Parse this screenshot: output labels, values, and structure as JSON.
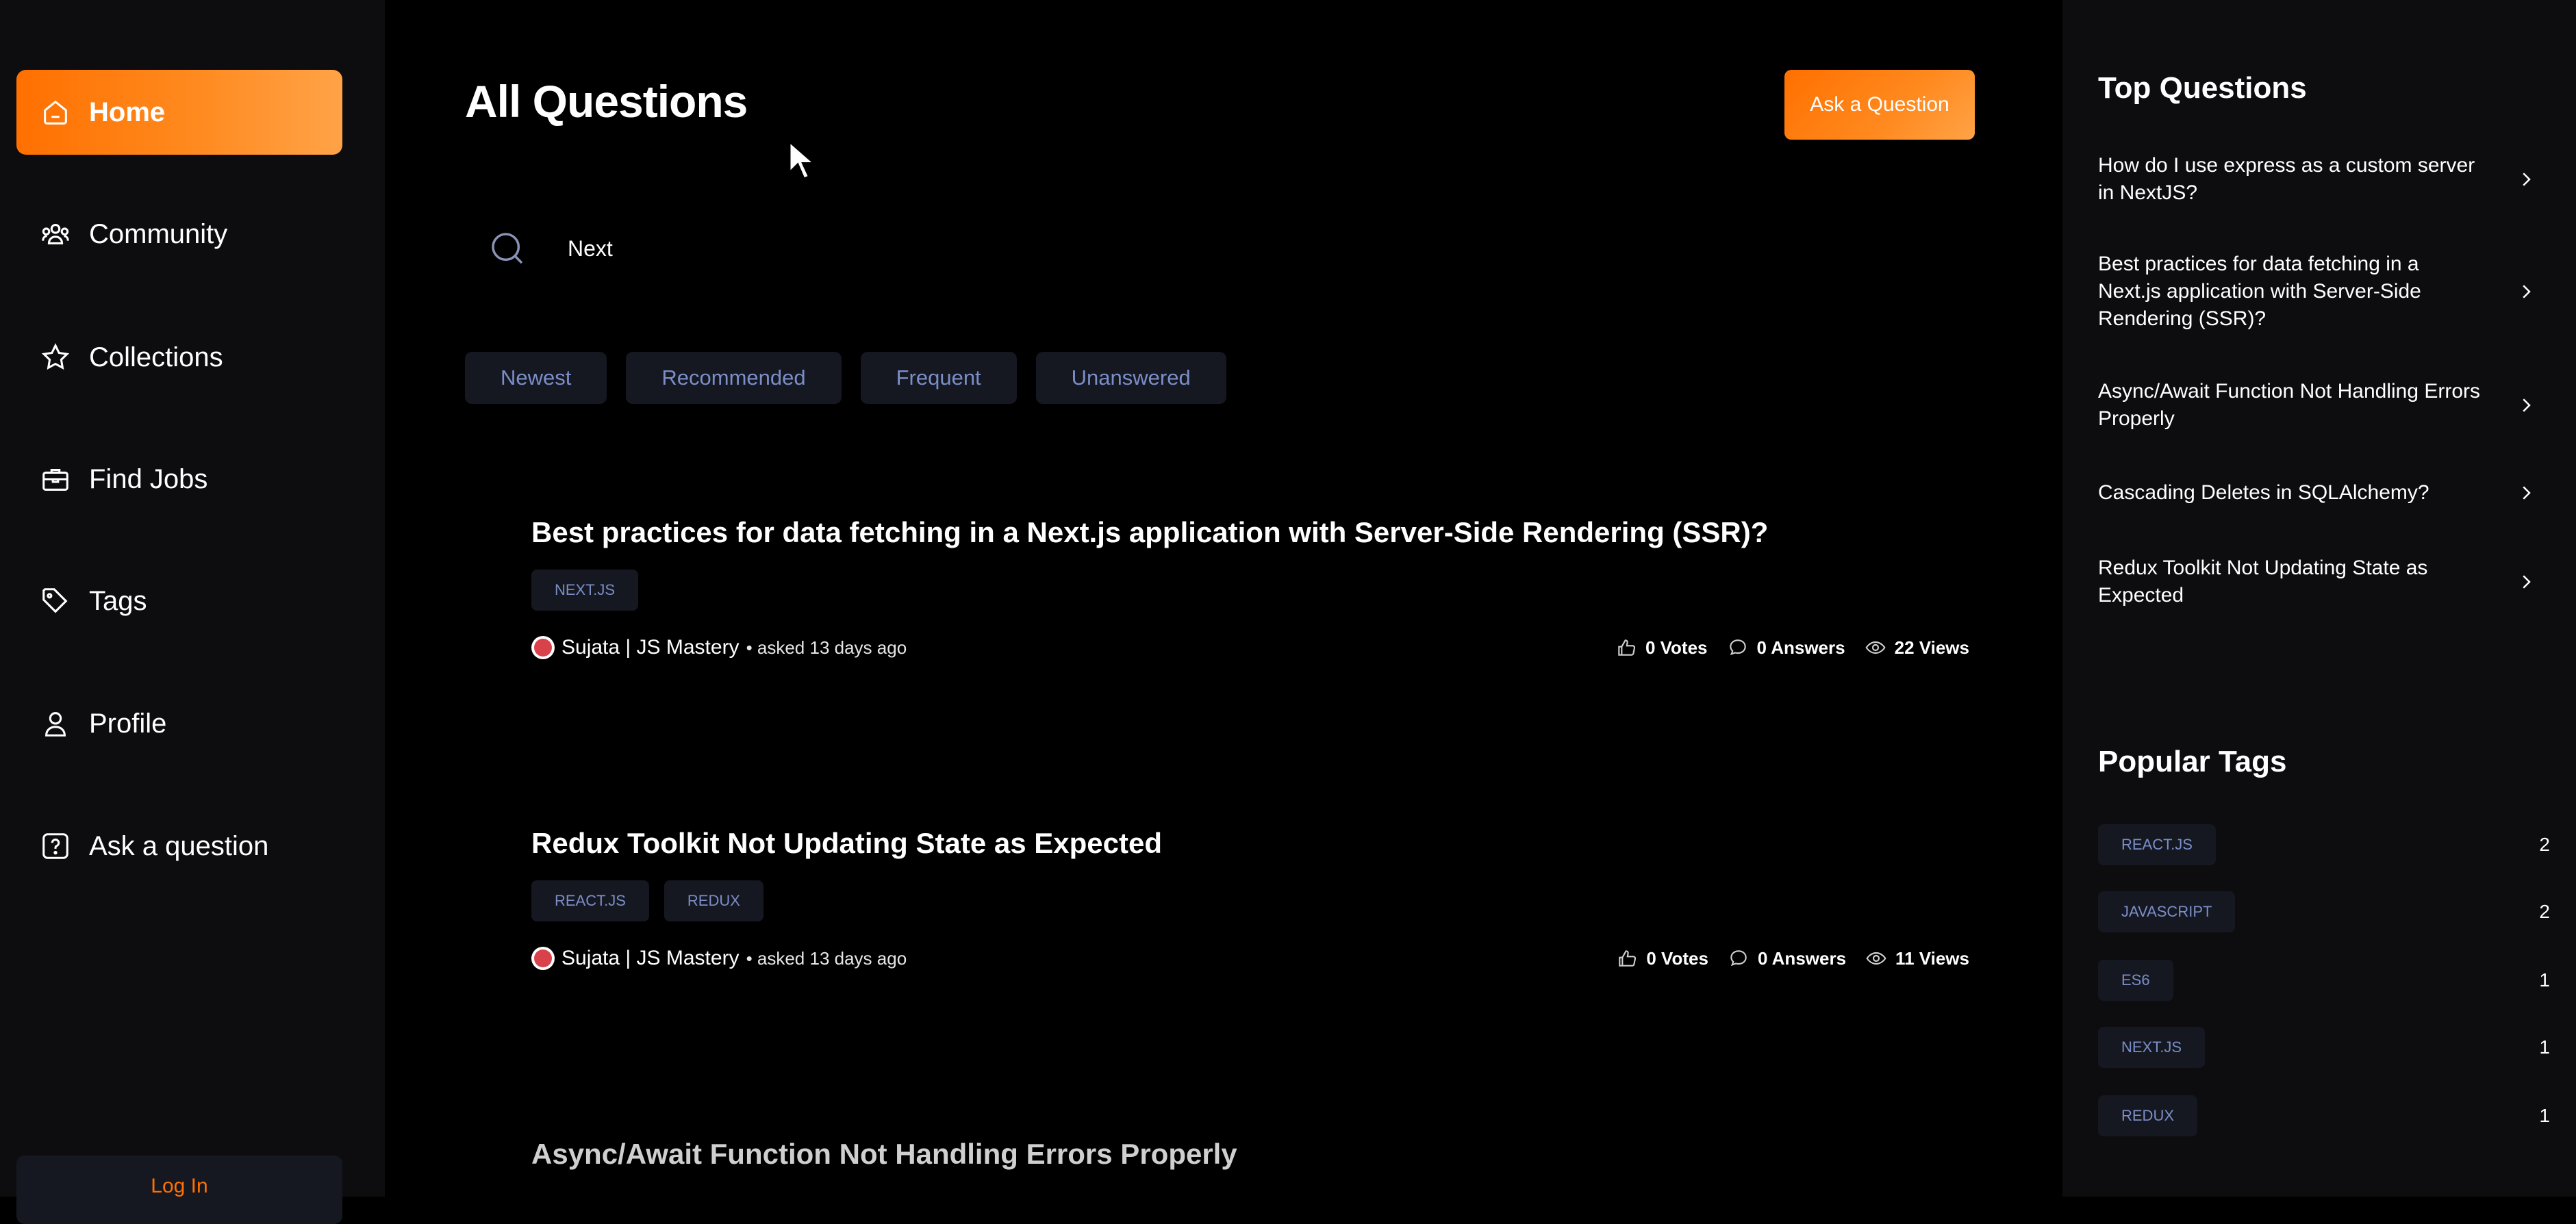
{
  "sidebar": {
    "items": [
      {
        "label": "Home",
        "icon": "home-icon",
        "active": true
      },
      {
        "label": "Community",
        "icon": "users-icon"
      },
      {
        "label": "Collections",
        "icon": "star-icon"
      },
      {
        "label": "Find Jobs",
        "icon": "briefcase-icon"
      },
      {
        "label": "Tags",
        "icon": "tag-icon"
      },
      {
        "label": "Profile",
        "icon": "user-icon"
      },
      {
        "label": "Ask a question",
        "icon": "question-icon"
      }
    ],
    "login_label": "Log In"
  },
  "main": {
    "title": "All Questions",
    "ask_button": "Ask a Question",
    "search": {
      "value": "Next",
      "icon": "search-icon"
    },
    "filters": [
      "Newest",
      "Recommended",
      "Frequent",
      "Unanswered"
    ],
    "questions": [
      {
        "title": "Best practices for data fetching in a Next.js application with Server-Side Rendering (SSR)?",
        "tags": [
          "NEXT.JS"
        ],
        "author": "Sujata | JS Mastery",
        "asked": "• asked 13 days ago",
        "votes": "0 Votes",
        "answers": "0 Answers",
        "views": "22 Views"
      },
      {
        "title": "Redux Toolkit Not Updating State as Expected",
        "tags": [
          "REACT.JS",
          "REDUX"
        ],
        "author": "Sujata | JS Mastery",
        "asked": "• asked 13 days ago",
        "votes": "0 Votes",
        "answers": "0 Answers",
        "views": "11 Views"
      },
      {
        "title": "Async/Await Function Not Handling Errors Properly"
      }
    ]
  },
  "right": {
    "top_title": "Top Questions",
    "top_questions": [
      "How do I use express as a custom server in NextJS?",
      "Best practices for data fetching in a Next.js application with Server-Side Rendering (SSR)?",
      "Async/Await Function Not Handling Errors Properly",
      "Cascading Deletes in SQLAlchemy?",
      "Redux Toolkit Not Updating State as Expected"
    ],
    "tags_title": "Popular Tags",
    "popular_tags": [
      {
        "name": "REACT.JS",
        "count": "2"
      },
      {
        "name": "JAVASCRIPT",
        "count": "2"
      },
      {
        "name": "ES6",
        "count": "1"
      },
      {
        "name": "NEXT.JS",
        "count": "1"
      },
      {
        "name": "REDUX",
        "count": "1"
      }
    ]
  },
  "colors": {
    "accent": "#ff7000",
    "tag_bg": "#151821",
    "tag_text": "#7b8ec8",
    "panel": "#0d0d0f"
  }
}
